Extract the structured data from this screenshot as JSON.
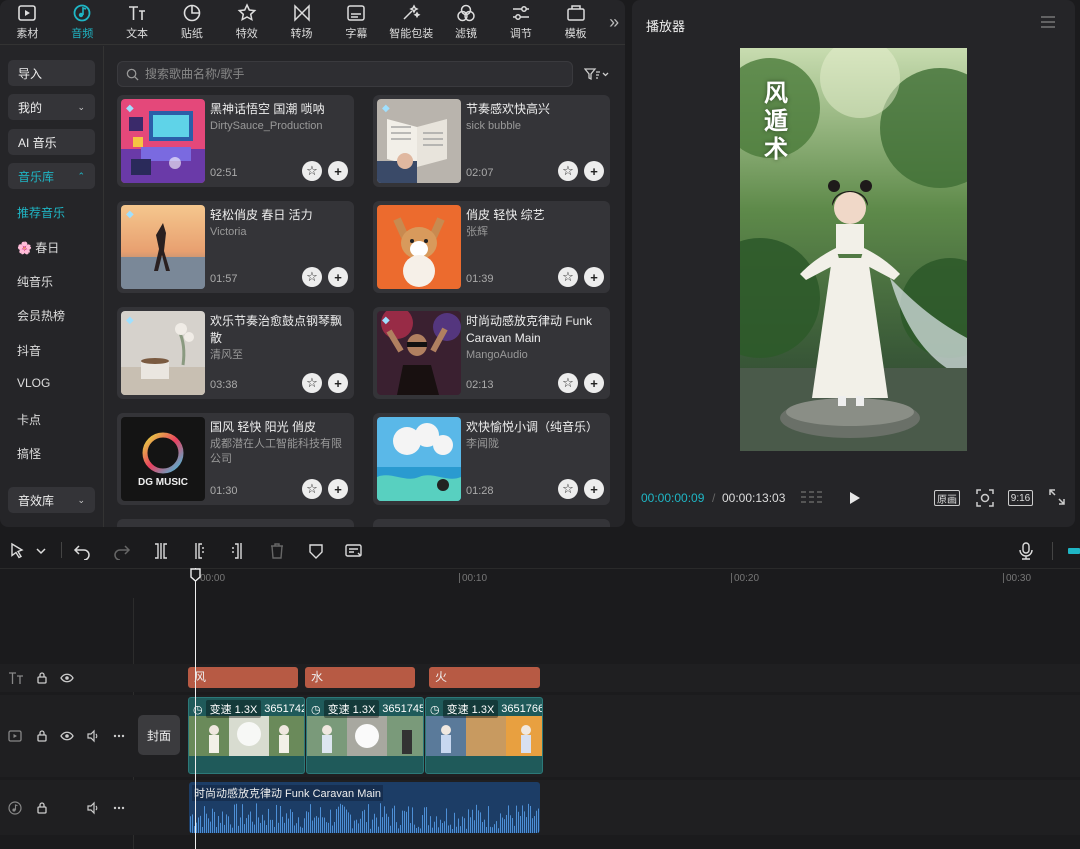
{
  "toolbar": {
    "tools": [
      {
        "label": "素材",
        "icon": "media-icon"
      },
      {
        "label": "音频",
        "icon": "audio-icon"
      },
      {
        "label": "文本",
        "icon": "text-icon"
      },
      {
        "label": "贴纸",
        "icon": "sticker-icon"
      },
      {
        "label": "特效",
        "icon": "effects-icon"
      },
      {
        "label": "转场",
        "icon": "transition-icon"
      },
      {
        "label": "字幕",
        "icon": "subtitle-icon"
      },
      {
        "label": "智能包装",
        "icon": "smart-pack-icon"
      },
      {
        "label": "滤镜",
        "icon": "filter-icon"
      },
      {
        "label": "调节",
        "icon": "adjust-icon"
      },
      {
        "label": "模板",
        "icon": "template-icon"
      }
    ],
    "active": "音频",
    "more": "»"
  },
  "sidebar": {
    "import": "导入",
    "mine": "我的",
    "ai_music": "AI 音乐",
    "library": "音乐库",
    "sub_items": [
      "推荐音乐",
      "🌸 春日",
      "纯音乐",
      "会员热榜",
      "抖音",
      "VLOG",
      "卡点",
      "搞怪"
    ],
    "sfx": "音效库"
  },
  "search": {
    "placeholder": "搜索歌曲名称/歌手"
  },
  "songs": [
    {
      "title": "黑神话悟空 国潮 唢呐",
      "artist": "DirtySauce_Production",
      "duration": "02:51"
    },
    {
      "title": "节奏感欢快高兴",
      "artist": "sick bubble",
      "duration": "02:07"
    },
    {
      "title": "轻松俏皮 春日 活力",
      "artist": "Victoria",
      "duration": "01:57"
    },
    {
      "title": "俏皮 轻快 综艺",
      "artist": "张辉",
      "duration": "01:39"
    },
    {
      "title": "欢乐节奏治愈鼓点钢琴飘散",
      "artist": "清风至",
      "duration": "03:38"
    },
    {
      "title": "时尚动感放克律动 Funk Caravan Main",
      "artist": "MangoAudio",
      "duration": "02:13"
    },
    {
      "title": "国风 轻快 阳光 俏皮",
      "artist": "成都潜在人工智能科技有限公司",
      "duration": "01:30"
    },
    {
      "title": "欢快愉悦小调（纯音乐）",
      "artist": "李闻陇",
      "duration": "01:28"
    }
  ],
  "thumb_texts": {
    "dg": "DG MUSIC"
  },
  "player": {
    "title": "播放器",
    "video_text": "风遁术",
    "current_time": "00:00:00:09",
    "separator": "/",
    "total_time": "00:00:13:03",
    "original_label": "原画",
    "ratio_label": "9:16"
  },
  "timeline": {
    "ticks": [
      "00:00",
      "00:10",
      "00:20",
      "00:30"
    ],
    "text_clips": [
      "风",
      "水",
      "火"
    ],
    "video_clips": [
      {
        "speed": "变速 1.3X",
        "id": "3651742"
      },
      {
        "speed": "变速 1.3X",
        "id": "3651745"
      },
      {
        "speed": "变速 1.3X",
        "id": "3651766"
      }
    ],
    "cover_label": "封面",
    "audio_clip": "时尚动感放克律动  Funk Caravan Main"
  },
  "colors": {
    "accent": "#1fb6c5",
    "text_clip": "#b75a44",
    "video_clip": "#1f5a5a",
    "audio_clip": "#1c3d66"
  }
}
